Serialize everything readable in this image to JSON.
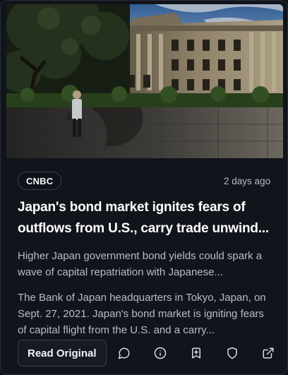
{
  "article": {
    "source": "CNBC",
    "time_ago": "2 days ago",
    "headline": "Japan's bond market ignites fears of outflows from U.S., carry trade unwind...",
    "summary": "Higher Japan government bond yields could spark a wave of capital repatriation with Japanese...",
    "caption": "The Bank of Japan headquarters in Tokyo, Japan, on Sept. 27, 2021. Japan's bond market is igniting fears of capital flight from the U.S. and a carry..."
  },
  "actions": {
    "read_label": "Read Original",
    "icons": [
      "comment-icon",
      "info-icon",
      "bookmark-icon",
      "shield-icon",
      "external-link-icon"
    ]
  },
  "colors": {
    "card_bg": "#11141b",
    "border": "#3a3f4b",
    "text_primary": "#ffffff",
    "text_secondary": "#b7bdc8",
    "icon": "#d8dce4"
  }
}
